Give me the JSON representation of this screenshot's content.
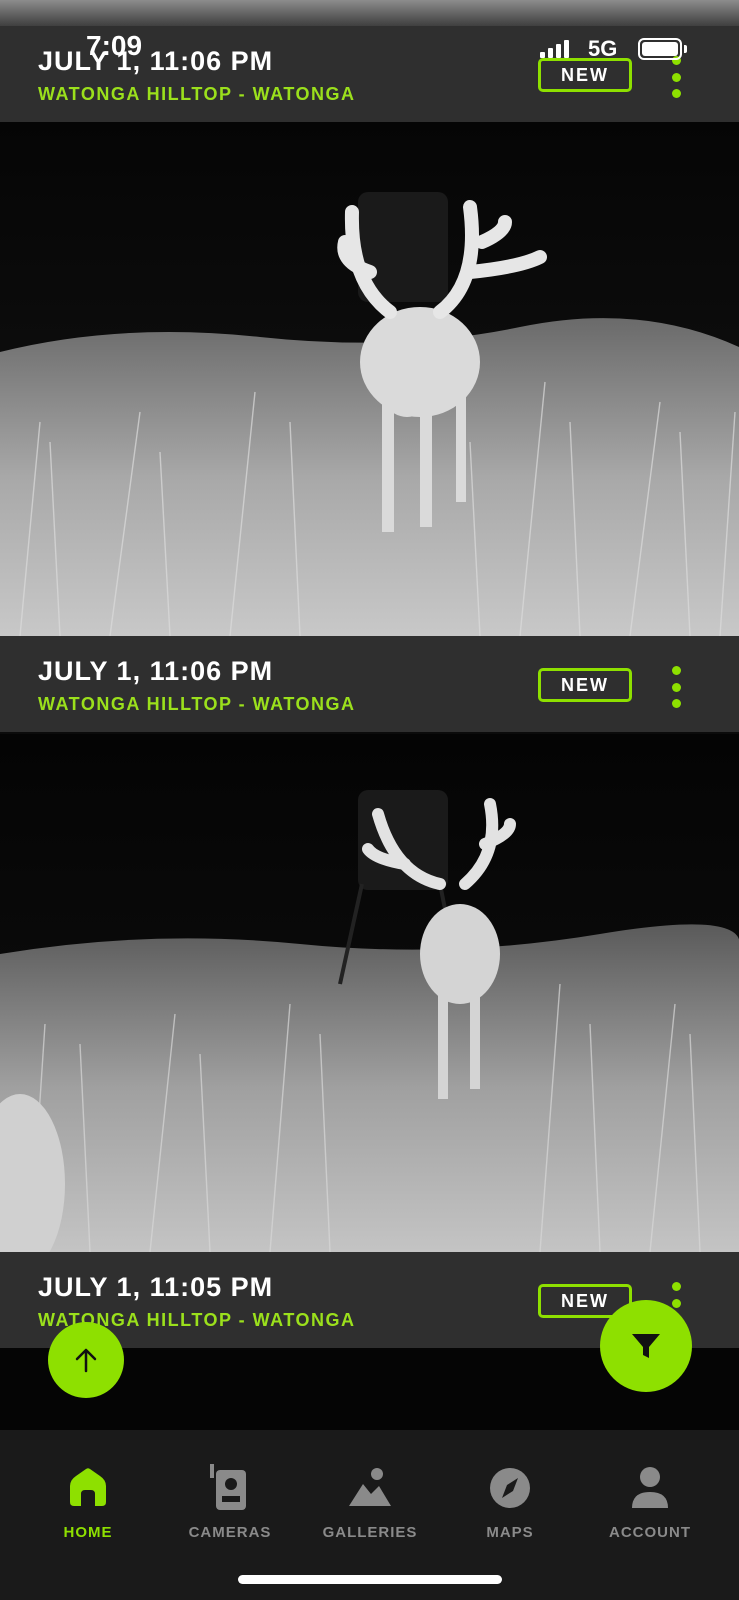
{
  "status_bar": {
    "time": "7:09",
    "network": "5G"
  },
  "feed": [
    {
      "title": "JULY 1, 11:06 PM",
      "location": "WATONGA HILLTOP - WATONGA",
      "badge": "NEW"
    },
    {
      "title": "JULY 1, 11:06 PM",
      "location": "WATONGA HILLTOP - WATONGA",
      "badge": "NEW"
    },
    {
      "title": "JULY 1, 11:05 PM",
      "location": "WATONGA HILLTOP - WATONGA",
      "badge": "NEW"
    }
  ],
  "bottom_nav": [
    {
      "label": "HOME",
      "icon": "home-icon",
      "active": true
    },
    {
      "label": "CAMERAS",
      "icon": "camera-icon",
      "active": false
    },
    {
      "label": "GALLERIES",
      "icon": "galleries-icon",
      "active": false
    },
    {
      "label": "MAPS",
      "icon": "compass-icon",
      "active": false
    },
    {
      "label": "ACCOUNT",
      "icon": "account-icon",
      "active": false
    }
  ],
  "colors": {
    "accent": "#8ee000",
    "header_bg": "#2f2f2f",
    "nav_bg": "#1a1a1a"
  }
}
